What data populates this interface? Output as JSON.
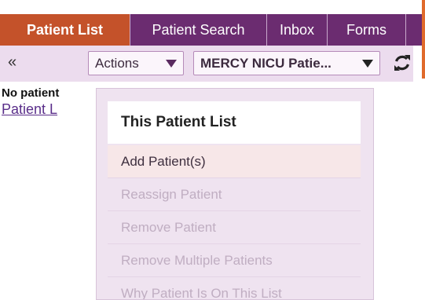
{
  "tabs": [
    {
      "label": "Patient List",
      "active": true
    },
    {
      "label": "Patient Search",
      "active": false
    },
    {
      "label": "Inbox",
      "active": false
    },
    {
      "label": "Forms",
      "active": false
    }
  ],
  "toolbar": {
    "collapse_icon": "«",
    "actions_label": "Actions",
    "list_select_value": "MERCY NICU Patie..."
  },
  "content": {
    "no_patients_text": "No patient",
    "patient_link_text": "Patient L"
  },
  "menu": {
    "header": "This Patient List",
    "items": [
      {
        "label": "Add Patient(s)",
        "enabled": true
      },
      {
        "label": "Reassign Patient",
        "enabled": false
      },
      {
        "label": "Remove Patient",
        "enabled": false
      },
      {
        "label": "Remove Multiple Patients",
        "enabled": false
      },
      {
        "label": "Why Patient Is On This List",
        "enabled": false
      }
    ]
  },
  "colors": {
    "tab_bar": "#6b2c70",
    "active_tab": "#c4522a",
    "toolbar": "#ecdcee",
    "menu_bg": "#efe3f0",
    "accent": "#e06a2b"
  }
}
